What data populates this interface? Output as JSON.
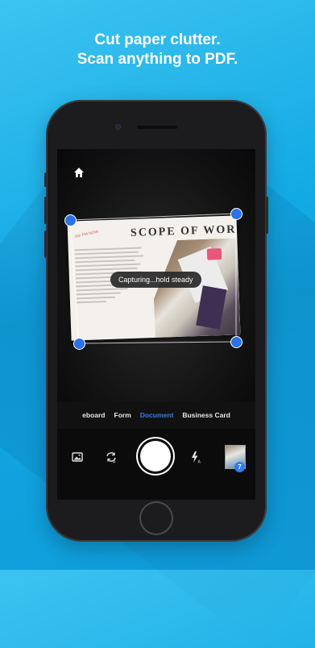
{
  "headline": {
    "line1": "Cut paper clutter.",
    "line2": "Scan anything to PDF."
  },
  "document": {
    "title": "SCOPE OF WORK",
    "handwritten_note": "Joe PM NOW"
  },
  "status_toast": "Capturing...hold steady",
  "modes": {
    "items": [
      "Whiteboard",
      "Form",
      "Document",
      "Business Card"
    ],
    "visible_labels": [
      "eboard",
      "Form",
      "Document",
      "Business Card"
    ],
    "selected": "Document"
  },
  "controls": {
    "left_icon": "photo-library-icon",
    "auto_capture_icon": "auto-capture-icon",
    "flash_icon": "flash-auto-icon",
    "scan_count": "7"
  },
  "colors": {
    "background": "#12a9e4",
    "accent": "#2d7df3"
  }
}
